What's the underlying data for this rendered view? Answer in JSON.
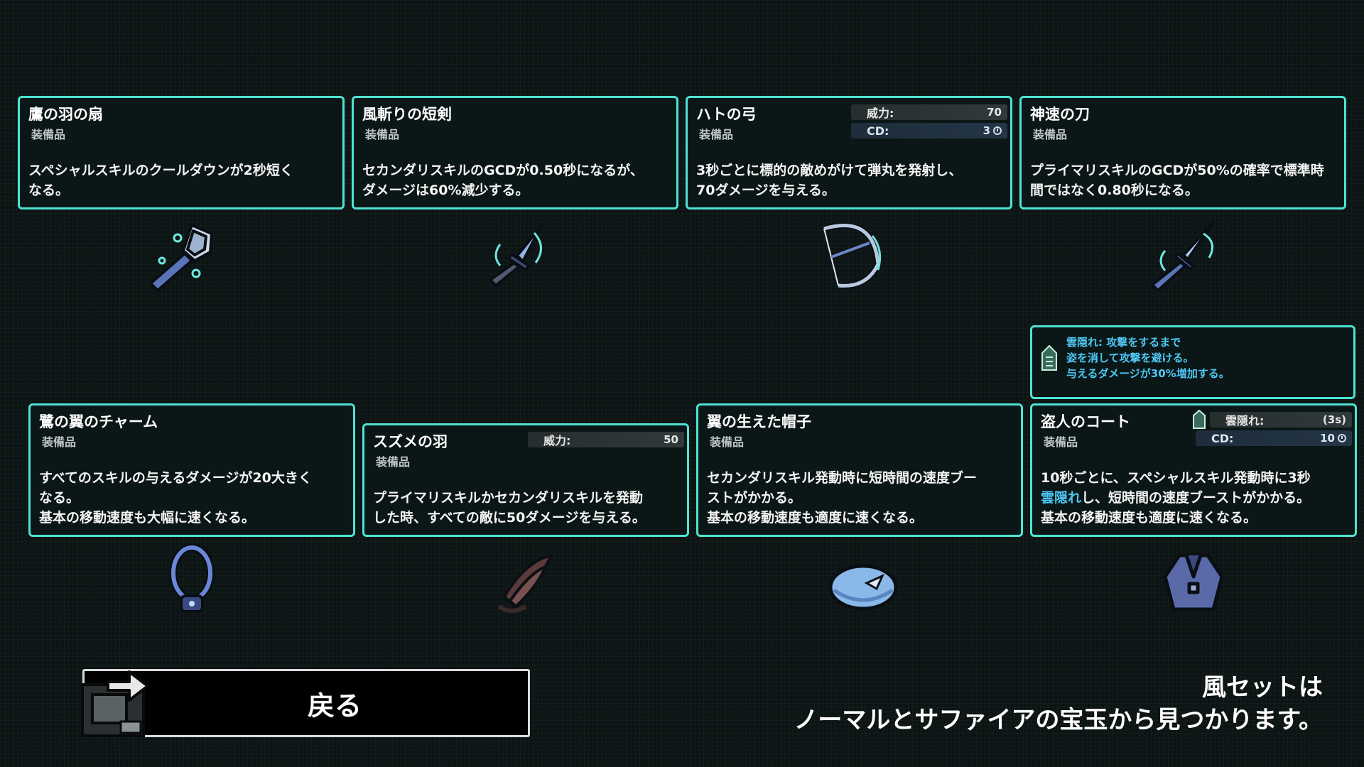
{
  "items": [
    {
      "name": "鷹の羽の扇",
      "type": "装備品",
      "desc": "スペシャルスキルのクールダウンが2秒短く\nなる。",
      "icon": "feather-fan-icon"
    },
    {
      "name": "風斬りの短剣",
      "type": "装備品",
      "desc": "セカンダリスキルのGCDが0.50秒になるが、\nダメージは60%減少する。",
      "icon": "dagger-icon"
    },
    {
      "name": "ハトの弓",
      "type": "装備品",
      "desc": "3秒ごとに標的の敵めがけて弾丸を発射し、\n70ダメージを与える。",
      "icon": "bow-icon",
      "power_label": "威力:",
      "power_value": "70",
      "cd_label": "CD:",
      "cd_value": "3"
    },
    {
      "name": "神速の刀",
      "type": "装備品",
      "desc": "プライマリスキルのGCDが50%の確率で標準時\n間ではなく0.80秒になる。",
      "icon": "sword-icon"
    },
    {
      "name": "鷺の翼のチャーム",
      "type": "装備品",
      "desc": "すべてのスキルの与えるダメージが20大きく\nなる。\n基本の移動速度も大幅に速くなる。",
      "icon": "charm-icon"
    },
    {
      "name": "スズメの羽",
      "type": "装備品",
      "desc": "プライマリスキルかセカンダリスキルを発動\nした時、すべての敵に50ダメージを与える。",
      "icon": "sparrow-feather-icon",
      "power_label": "威力:",
      "power_value": "50"
    },
    {
      "name": "翼の生えた帽子",
      "type": "装備品",
      "desc": "セカンダリスキル発動時に短時間の速度ブー\nストがかかる。\n基本の移動速度も適度に速くなる。",
      "icon": "winged-hat-icon"
    },
    {
      "name": "盗人のコート",
      "type": "装備品",
      "desc_before": "10秒ごとに、スペシャルスキル発動時に3秒\n",
      "desc_highlight": "雲隠れ",
      "desc_after": "し、短時間の速度ブーストがかかる。\n基本の移動速度も適度に速くなる。",
      "icon": "coat-icon",
      "status_label": "雲隠れ:",
      "status_value": "(3s)",
      "cd_label": "CD:",
      "cd_value": "10"
    }
  ],
  "tooltip": {
    "text": "雲隠れ: 攻撃をするまで\n姿を消して攻撃を避ける。\n与えるダメージが30%増加する。"
  },
  "back_button": {
    "label": "戻る"
  },
  "footer": {
    "line1": "風セットは",
    "line2": "ノーマルとサファイアの宝玉から見つかります。"
  },
  "colors": {
    "accent": "#4fe3d2",
    "highlight": "#4fc7f5"
  }
}
